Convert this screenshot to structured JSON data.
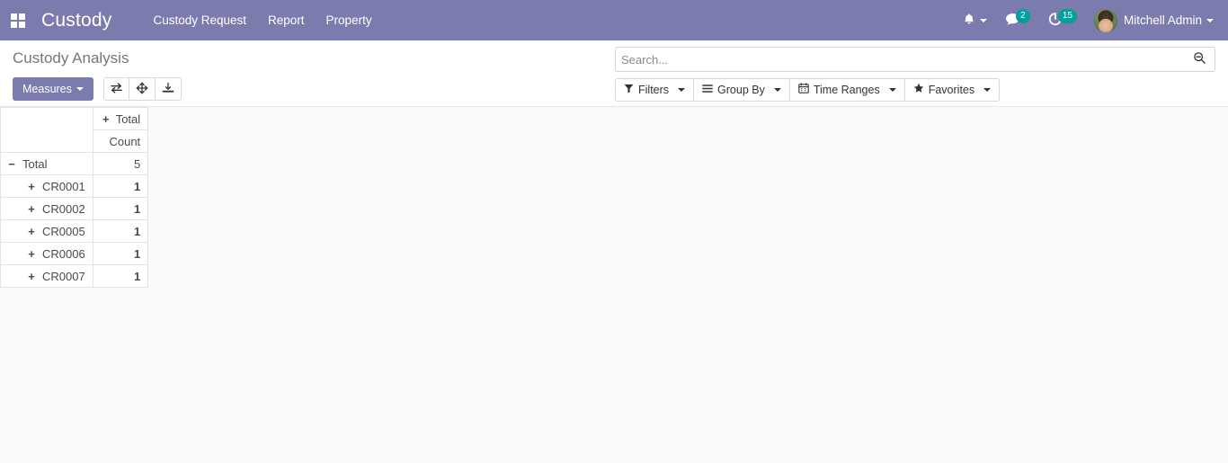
{
  "navbar": {
    "apps_icon": "apps-grid-icon",
    "brand": "Custody",
    "menu": [
      {
        "label": "Custody Request"
      },
      {
        "label": "Report"
      },
      {
        "label": "Property"
      }
    ],
    "activity_icon": "bell-icon",
    "messages_icon": "chat-bubble-icon",
    "messages_count": "2",
    "timer_icon": "clock-icon",
    "timer_count": "15",
    "user_name": "Mitchell Admin",
    "brand_color": "#7c7bad",
    "badge_color": "#00A09D"
  },
  "control_panel": {
    "title": "Custody Analysis",
    "measures_label": "Measures",
    "icon_buttons": [
      {
        "name": "flip-axis-icon"
      },
      {
        "name": "expand-all-icon"
      },
      {
        "name": "download-xlsx-icon"
      }
    ],
    "search": {
      "value": "",
      "placeholder": "Search...",
      "icon": "search-icon"
    },
    "filters": [
      {
        "label": "Filters",
        "icon": "funnel-icon"
      },
      {
        "label": "Group By",
        "icon": "bars-icon"
      },
      {
        "label": "Time Ranges",
        "icon": "calendar-icon"
      },
      {
        "label": "Favorites",
        "icon": "star-icon"
      }
    ]
  },
  "pivot": {
    "corner": "",
    "column_header": {
      "toggle": "+",
      "label": "Total"
    },
    "measure_header": "Count",
    "rows": [
      {
        "toggle": "−",
        "label": "Total",
        "level": 0,
        "value": "5",
        "is_total": true
      },
      {
        "toggle": "+",
        "label": "CR0001",
        "level": 1,
        "value": "1",
        "is_total": false
      },
      {
        "toggle": "+",
        "label": "CR0002",
        "level": 1,
        "value": "1",
        "is_total": false
      },
      {
        "toggle": "+",
        "label": "CR0005",
        "level": 1,
        "value": "1",
        "is_total": false
      },
      {
        "toggle": "+",
        "label": "CR0006",
        "level": 1,
        "value": "1",
        "is_total": false
      },
      {
        "toggle": "+",
        "label": "CR0007",
        "level": 1,
        "value": "1",
        "is_total": false
      }
    ]
  }
}
